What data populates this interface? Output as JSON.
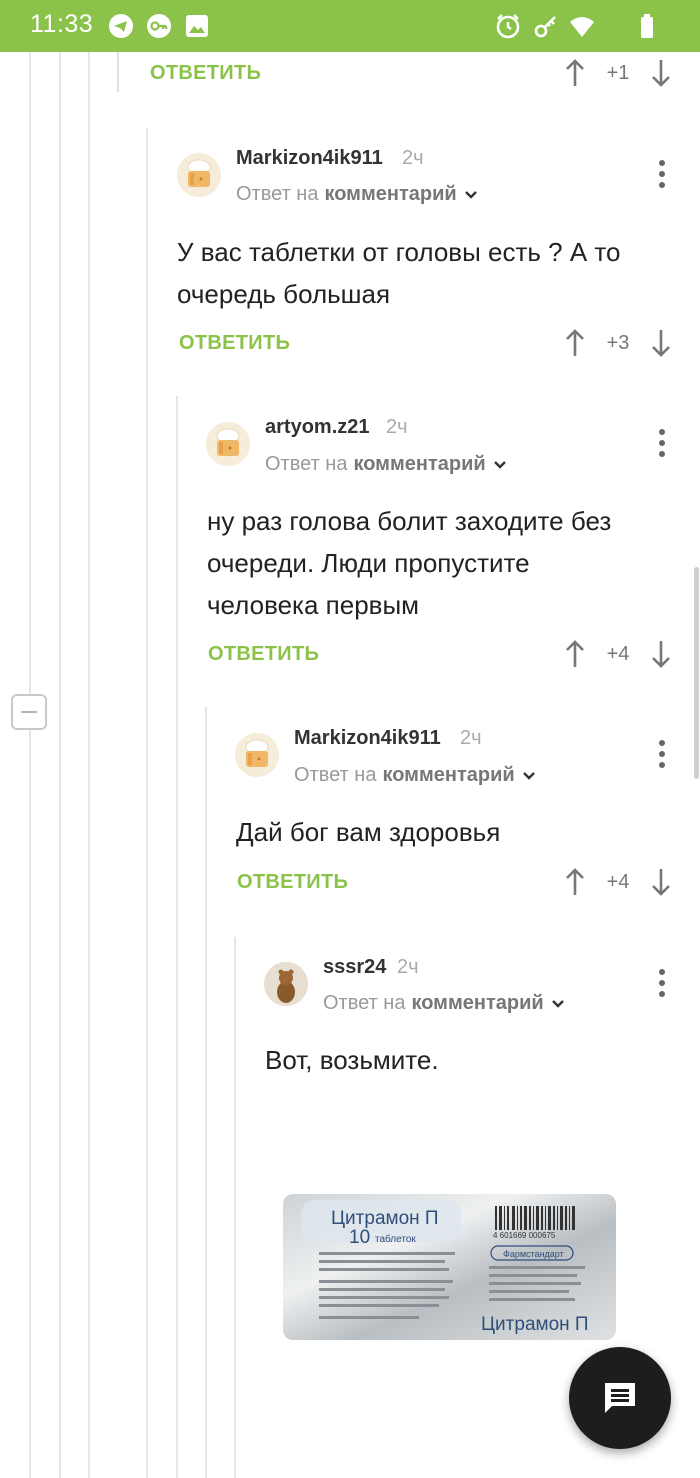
{
  "status_bar": {
    "time": "11:33",
    "left_icons": [
      "telegram-icon",
      "vpn-key-icon",
      "image-icon"
    ],
    "right_icons": [
      "alarm-icon",
      "key-icon",
      "wifi-icon",
      "battery-icon"
    ],
    "background_color": "#8bc34a"
  },
  "top_actions": {
    "reply_label": "ОТВЕТИТЬ",
    "score": "+1"
  },
  "comments": [
    {
      "username": "Markizon4ik911",
      "age": "2ч",
      "reply_prefix": "Ответ на",
      "reply_link": "комментарий",
      "text": "У вас таблетки от головы есть ? А то очередь большая",
      "reply_label": "ОТВЕТИТЬ",
      "score": "+3"
    },
    {
      "username": "artyom.z21",
      "age": "2ч",
      "reply_prefix": "Ответ на",
      "reply_link": "комментарий",
      "text": "ну раз голова болит заходите без очереди. Люди пропустите человека первым",
      "reply_label": "ОТВЕТИТЬ",
      "score": "+4"
    },
    {
      "username": "Markizon4ik911",
      "age": "2ч",
      "reply_prefix": "Ответ на",
      "reply_link": "комментарий",
      "text": "Дай бог вам здоровья",
      "reply_label": "ОТВЕТИТЬ",
      "score": "+4"
    },
    {
      "username": "sssr24",
      "age": "2ч",
      "reply_prefix": "Ответ на",
      "reply_link": "комментарий",
      "text": "Вот, возьмите."
    }
  ],
  "attached_image": {
    "brand_top": "Цитрамон П",
    "count": "10",
    "count_label": "таблеток",
    "brand_bottom": "Цитрамон П",
    "maker": "Фармстандарт",
    "barcode": "4 601669 000675"
  },
  "accent_color": "#8bc34a"
}
